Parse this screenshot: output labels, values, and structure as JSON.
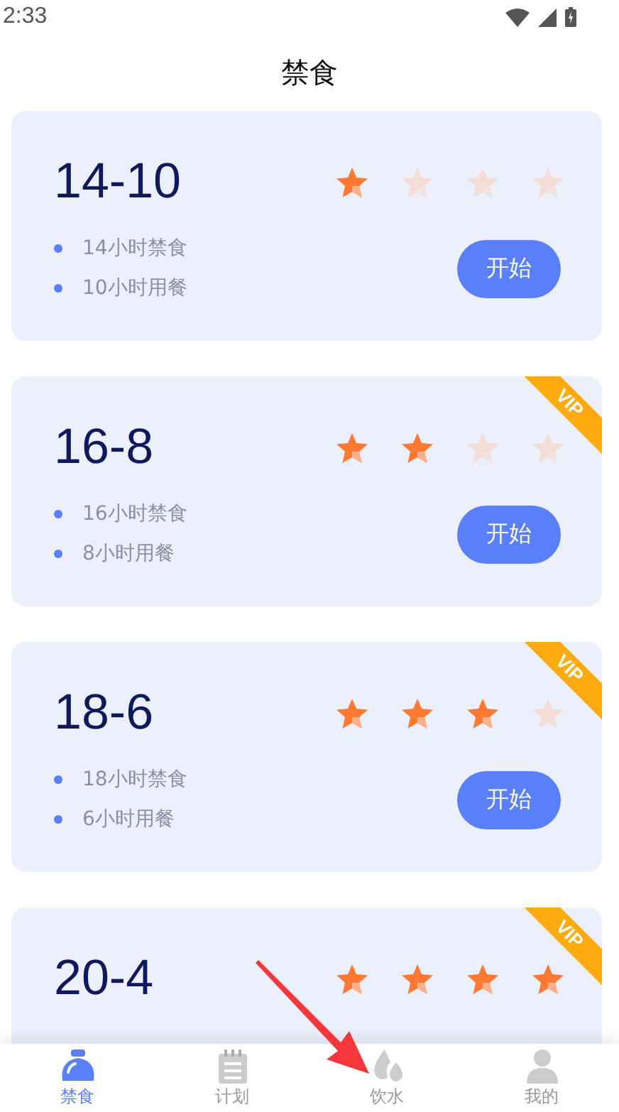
{
  "status_bar": {
    "time": "2:33"
  },
  "title": "禁食",
  "plans": [
    {
      "name": "14-10",
      "stars": 1,
      "lines": [
        "14小时禁食",
        "10小时用餐"
      ],
      "button": "开始"
    },
    {
      "name": "16-8",
      "stars": 2,
      "badge": "VIP",
      "lines": [
        "16小时禁食",
        "8小时用餐"
      ],
      "button": "开始"
    },
    {
      "name": "18-6",
      "stars": 3,
      "badge": "VIP",
      "lines": [
        "18小时禁食",
        "6小时用餐"
      ],
      "button": "开始"
    },
    {
      "name": "20-4",
      "stars": 4,
      "badge": "VIP"
    }
  ],
  "nav": [
    {
      "label": "禁食",
      "kind": "fast",
      "selected": true
    },
    {
      "label": "计划",
      "kind": "plan",
      "selected": false
    },
    {
      "label": "饮水",
      "kind": "water",
      "selected": false
    },
    {
      "label": "我的",
      "kind": "me",
      "selected": false
    }
  ]
}
